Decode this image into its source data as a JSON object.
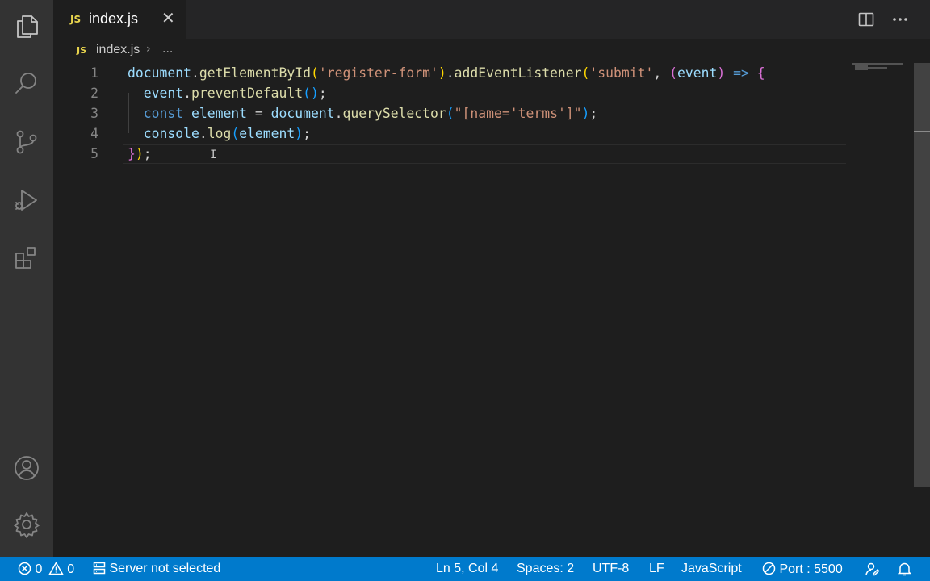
{
  "tab": {
    "icon_label": "JS",
    "filename": "index.js",
    "close_glyph": "✕"
  },
  "breadcrumb": {
    "icon_label": "JS",
    "file": "index.js",
    "separator": "›",
    "ellipsis": "..."
  },
  "editor": {
    "line_numbers": [
      "1",
      "2",
      "3",
      "4",
      "5"
    ],
    "lines": [
      [
        {
          "t": "document",
          "c": "t-var"
        },
        {
          "t": ".",
          "c": "t-pun"
        },
        {
          "t": "getElementById",
          "c": "t-fn"
        },
        {
          "t": "(",
          "c": "t-b1"
        },
        {
          "t": "'register-form'",
          "c": "t-str"
        },
        {
          "t": ")",
          "c": "t-b1"
        },
        {
          "t": ".",
          "c": "t-pun"
        },
        {
          "t": "addEventListener",
          "c": "t-fn"
        },
        {
          "t": "(",
          "c": "t-b1"
        },
        {
          "t": "'submit'",
          "c": "t-str"
        },
        {
          "t": ", ",
          "c": "t-pun"
        },
        {
          "t": "(",
          "c": "t-b2"
        },
        {
          "t": "event",
          "c": "t-var"
        },
        {
          "t": ")",
          "c": "t-b2"
        },
        {
          "t": " ",
          "c": "t-pun"
        },
        {
          "t": "=>",
          "c": "t-kw"
        },
        {
          "t": " ",
          "c": "t-pun"
        },
        {
          "t": "{",
          "c": "t-b2"
        }
      ],
      [
        {
          "t": "  ",
          "c": "t-pun"
        },
        {
          "t": "event",
          "c": "t-var"
        },
        {
          "t": ".",
          "c": "t-pun"
        },
        {
          "t": "preventDefault",
          "c": "t-fn"
        },
        {
          "t": "()",
          "c": "t-b3"
        },
        {
          "t": ";",
          "c": "t-pun"
        }
      ],
      [
        {
          "t": "  ",
          "c": "t-pun"
        },
        {
          "t": "const",
          "c": "t-kw"
        },
        {
          "t": " ",
          "c": "t-pun"
        },
        {
          "t": "element",
          "c": "t-var"
        },
        {
          "t": " = ",
          "c": "t-pun"
        },
        {
          "t": "document",
          "c": "t-var"
        },
        {
          "t": ".",
          "c": "t-pun"
        },
        {
          "t": "querySelector",
          "c": "t-fn"
        },
        {
          "t": "(",
          "c": "t-b3"
        },
        {
          "t": "\"[name='terms']\"",
          "c": "t-str"
        },
        {
          "t": ")",
          "c": "t-b3"
        },
        {
          "t": ";",
          "c": "t-pun"
        }
      ],
      [
        {
          "t": "  ",
          "c": "t-pun"
        },
        {
          "t": "console",
          "c": "t-var"
        },
        {
          "t": ".",
          "c": "t-pun"
        },
        {
          "t": "log",
          "c": "t-fn"
        },
        {
          "t": "(",
          "c": "t-b3"
        },
        {
          "t": "element",
          "c": "t-var"
        },
        {
          "t": ")",
          "c": "t-b3"
        },
        {
          "t": ";",
          "c": "t-pun"
        }
      ],
      [
        {
          "t": "}",
          "c": "t-b2"
        },
        {
          "t": ")",
          "c": "t-b1"
        },
        {
          "t": ";",
          "c": "t-pun"
        }
      ]
    ]
  },
  "status": {
    "errors": "0",
    "warnings": "0",
    "server": "Server not selected",
    "position": "Ln 5, Col 4",
    "spaces": "Spaces: 2",
    "encoding": "UTF-8",
    "eol": "LF",
    "language": "JavaScript",
    "port": "Port : 5500"
  },
  "colors": {
    "status_bar": "#007acc",
    "activity_bar": "#333333",
    "editor_bg": "#1e1e1e",
    "js_badge": "#e8d44d"
  }
}
